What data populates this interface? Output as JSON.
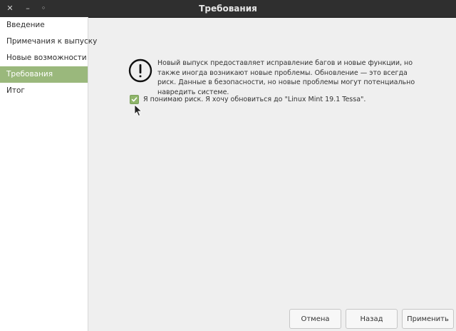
{
  "window": {
    "title": "Требования",
    "close_glyph": "✕",
    "minimize_glyph": "–",
    "maximize_glyph": "◦"
  },
  "sidebar": {
    "items": [
      {
        "label": "Введение"
      },
      {
        "label": "Примечания к выпуску"
      },
      {
        "label": "Новые возможности"
      },
      {
        "label": "Требования",
        "active": true
      },
      {
        "label": "Итог"
      }
    ]
  },
  "warning": {
    "icon": "exclamation-circle-icon",
    "text": "Новый выпуск предоставляет исправление багов и новые функции, но также иногда возникают новые проблемы. Обновление — это всегда риск. Данные в безопасности, но новые проблемы могут потенциально навредить системе."
  },
  "consent": {
    "checked": true,
    "label": "Я понимаю риск. Я хочу обновиться до \"Linux Mint 19.1 Tessa\"."
  },
  "buttons": {
    "cancel": "Отмена",
    "back": "Назад",
    "apply": "Применить"
  },
  "colors": {
    "accent": "#9ab87c",
    "titlebar": "#2f2f2f",
    "background": "#efefef"
  }
}
